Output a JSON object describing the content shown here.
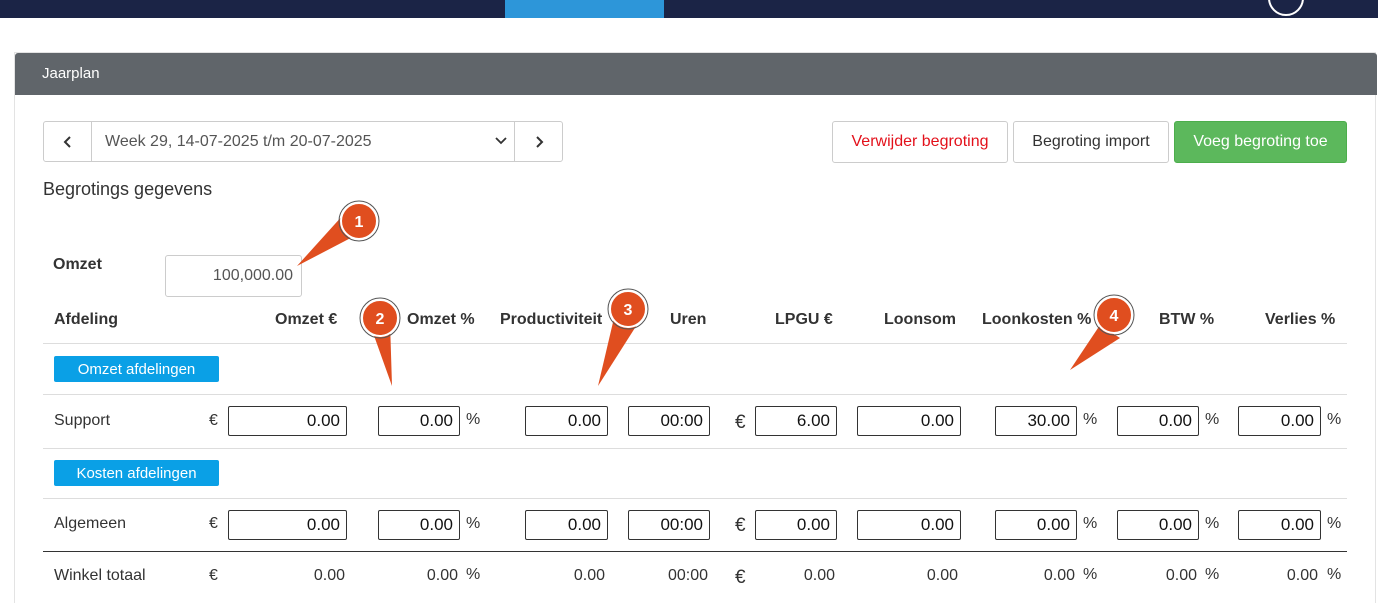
{
  "panel": {
    "title": "Jaarplan"
  },
  "week_nav": {
    "prev": "‹",
    "next": "›",
    "selected": "Week 29, 14-07-2025 t/m 20-07-2025"
  },
  "buttons": {
    "delete": "Verwijder begroting",
    "import": "Begroting import",
    "add": "Voeg begroting toe"
  },
  "section_title": "Begrotings gegevens",
  "omzet": {
    "label": "Omzet",
    "value": "100,000.00"
  },
  "headers": {
    "afdeling": "Afdeling",
    "omzet_eur": "Omzet €",
    "omzet_pct": "Omzet %",
    "productiviteit": "Productiviteit",
    "uren": "Uren",
    "lpgu": "LPGU €",
    "loonsom": "Loonsom",
    "loonkosten": "Loonkosten %",
    "btw": "BTW %",
    "verlies": "Verlies %"
  },
  "symbols": {
    "euro": "€",
    "pct": "%"
  },
  "groups": {
    "omzet": "Omzet afdelingen",
    "kosten": "Kosten afdelingen"
  },
  "rows": {
    "support": {
      "label": "Support",
      "omzet": "0.00",
      "omzet_pct": "0.00",
      "productiviteit": "0.00",
      "uren": "00:00",
      "lpgu": "6.00",
      "loonsom": "0.00",
      "loonkosten": "30.00",
      "btw": "0.00",
      "verlies": "0.00"
    },
    "algemeen": {
      "label": "Algemeen",
      "omzet": "0.00",
      "omzet_pct": "0.00",
      "productiviteit": "0.00",
      "uren": "00:00",
      "lpgu": "0.00",
      "loonsom": "0.00",
      "loonkosten": "0.00",
      "btw": "0.00",
      "verlies": "0.00"
    },
    "totaal": {
      "label": "Winkel totaal",
      "omzet": "0.00",
      "omzet_pct": "0.00",
      "productiviteit": "0.00",
      "uren": "00:00",
      "lpgu": "0.00",
      "loonsom": "0.00",
      "loonkosten": "0.00",
      "btw": "0.00",
      "verlies": "0.00"
    }
  },
  "callouts": [
    "1",
    "2",
    "3",
    "4"
  ],
  "colors": {
    "navbar": "#1b2446",
    "active_tab": "#2d96d9",
    "callout": "#e04e1f",
    "add_button": "#5cb85c",
    "group_button": "#0aa0e6",
    "delete_text": "#e3111b"
  }
}
